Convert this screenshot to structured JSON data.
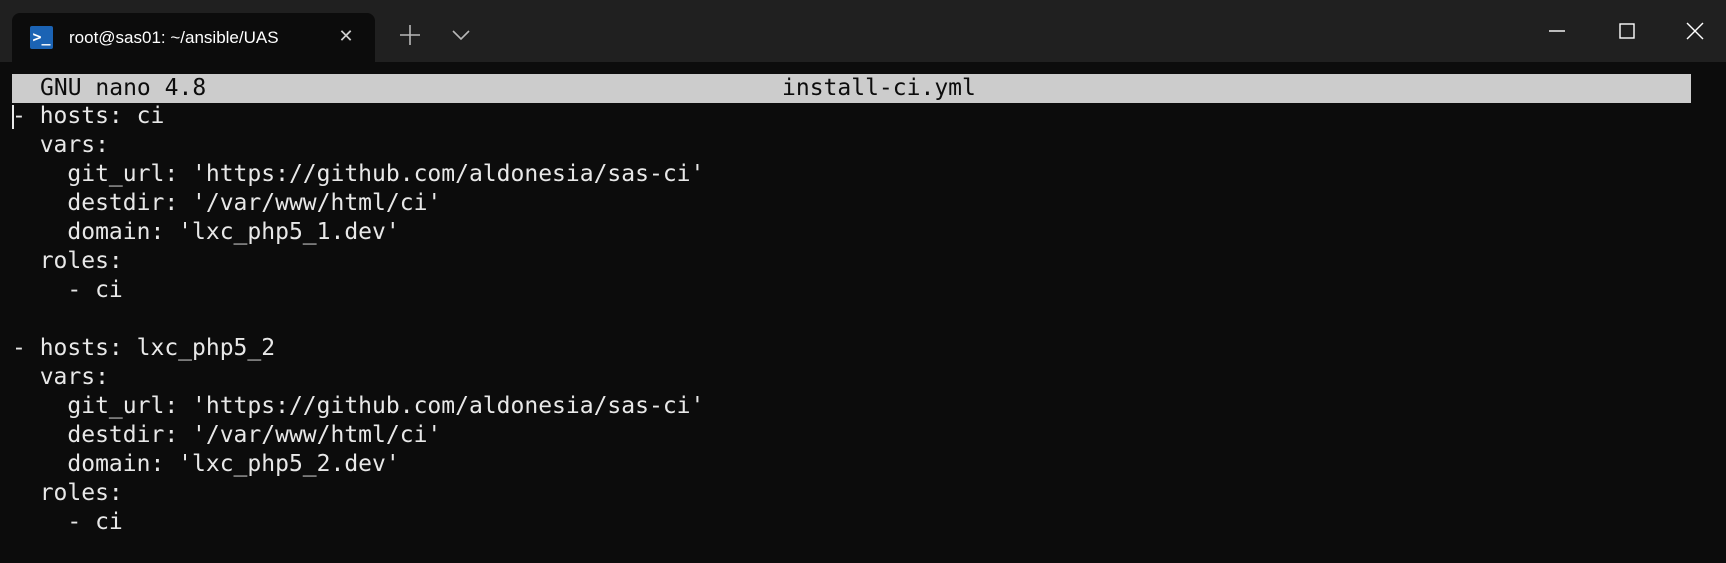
{
  "window": {
    "tab_title": "root@sas01: ~/ansible/UAS",
    "icons": {
      "tab": "powershell-icon",
      "close_tab": "close-icon",
      "new_tab": "plus-icon",
      "dropdown": "chevron-down-icon",
      "minimize": "minimize-icon",
      "maximize": "maximize-icon",
      "close_window": "close-icon"
    },
    "colors": {
      "titlebar": "#202020",
      "tab_active": "#0c0c0c",
      "terminal_bg": "#0c0c0c",
      "terminal_fg": "#e8e8e8",
      "nano_header_bg": "#cccccc"
    }
  },
  "nano": {
    "app_version": "GNU nano 4.8",
    "filename": "install-ci.yml"
  },
  "file_lines": [
    "- hosts: ci",
    "  vars:",
    "    git_url: 'https://github.com/aldonesia/sas-ci'",
    "    destdir: '/var/www/html/ci'",
    "    domain: 'lxc_php5_1.dev'",
    "  roles:",
    "    - ci",
    "",
    "- hosts: lxc_php5_2",
    "  vars:",
    "    git_url: 'https://github.com/aldonesia/sas-ci'",
    "    destdir: '/var/www/html/ci'",
    "    domain: 'lxc_php5_2.dev'",
    "  roles:",
    "    - ci"
  ]
}
